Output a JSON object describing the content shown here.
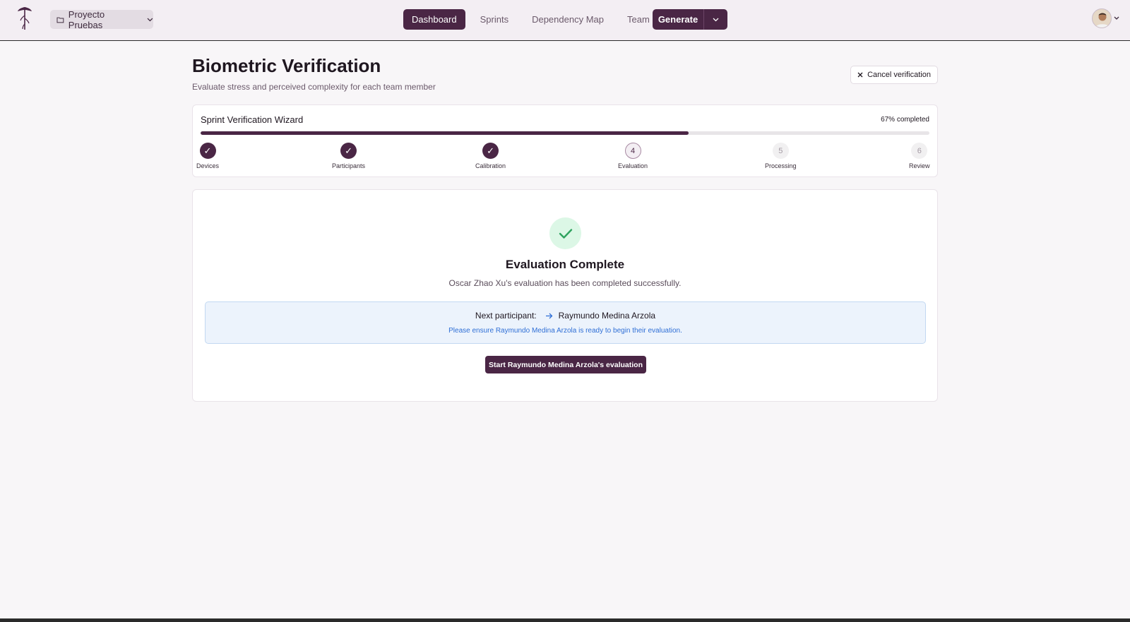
{
  "header": {
    "project": {
      "label": "Proyecto Pruebas",
      "icon": "folder-icon"
    },
    "nav": [
      {
        "label": "Dashboard",
        "active": true
      },
      {
        "label": "Sprints",
        "active": false
      },
      {
        "label": "Dependency Map",
        "active": false
      },
      {
        "label": "Team",
        "active": false
      }
    ],
    "generate_label": "Generate"
  },
  "page": {
    "title": "Biometric Verification",
    "subtitle": "Evaluate stress and perceived complexity for each team member",
    "cancel_label": "Cancel verification"
  },
  "wizard": {
    "title": "Sprint Verification Wizard",
    "progress_text": "67% completed",
    "progress_fraction": 0.67,
    "steps": [
      {
        "number": "1",
        "label": "Devices",
        "state": "done"
      },
      {
        "number": "2",
        "label": "Participants",
        "state": "done"
      },
      {
        "number": "3",
        "label": "Calibration",
        "state": "done"
      },
      {
        "number": "4",
        "label": "Evaluation",
        "state": "current"
      },
      {
        "number": "5",
        "label": "Processing",
        "state": "pending"
      },
      {
        "number": "6",
        "label": "Review",
        "state": "pending"
      }
    ]
  },
  "result": {
    "title": "Evaluation Complete",
    "message": "Oscar Zhao Xu's evaluation has been completed successfully.",
    "next_label": "Next participant:",
    "next_name": "Raymundo Medina Arzola",
    "next_note": "Please ensure Raymundo Medina Arzola is ready to begin their evaluation.",
    "start_button": "Start Raymundo Medina Arzola's evaluation"
  },
  "colors": {
    "brand": "#4a2645",
    "success_bg": "#dcf7e6",
    "success": "#2fa35f",
    "info_bg": "#ecf3fc",
    "info_text": "#2f6fd6"
  }
}
